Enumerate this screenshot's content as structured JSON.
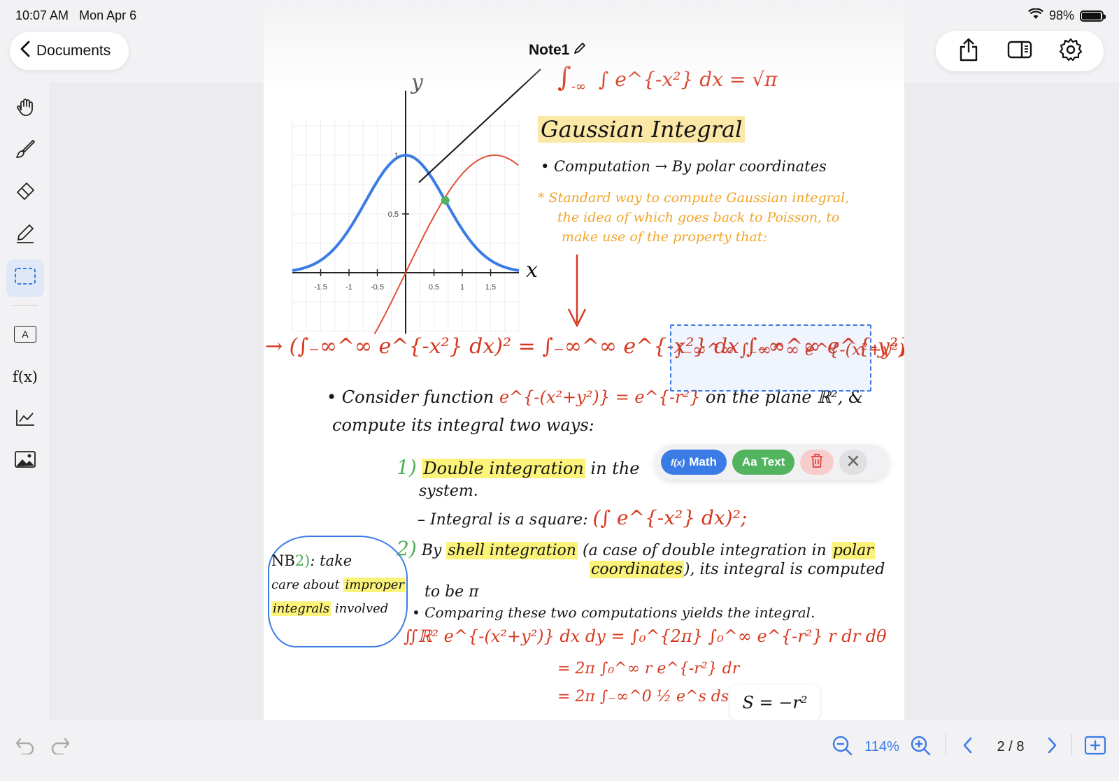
{
  "status": {
    "time": "10:07 AM",
    "date": "Mon Apr 6",
    "battery": "98%",
    "battery_level": 0.98
  },
  "nav": {
    "back_label": "Documents"
  },
  "document": {
    "title": "Note1"
  },
  "tools": [
    "hand-tool",
    "brush-tool",
    "eraser-tool",
    "highlighter-tool",
    "lasso-select-tool",
    "text-box-tool",
    "function-tool",
    "graph-tool",
    "image-tool"
  ],
  "tool_labels": {
    "textbox": "A",
    "function": "f(x)"
  },
  "graph": {
    "y_label": "y",
    "x_label": "x",
    "x_ticks": [
      "-1.5",
      "-1",
      "-0.5",
      "0.5",
      "1",
      "1.5"
    ],
    "y_ticks": [
      "1",
      "0.5"
    ]
  },
  "notes": {
    "top_formula": "∫ e^{-x²} dx = √π",
    "top_formula_lower": "-∞",
    "heading": "Gaussian Integral",
    "computation": "• Computation → By polar coordinates",
    "note_line1": "* Standard way to compute Gaussian integral,",
    "note_line2": "the idea of which goes back to Poisson, to",
    "note_line3": "make use of the property that:",
    "main_equation": "→ (∫₋∞^∞ e^{-x²} dx)² = ∫₋∞^∞ e^{-x²} dx ∫₋∞^∞ e^{-y²} dy =",
    "selected_expr": "∫₋∞^∞ ∫₋∞^∞ e^{-(x²+y²)} dx dy",
    "consider_line1a": "• Consider function",
    "consider_expr": "e^{-(x²+y²)} = e^{-r²}",
    "consider_line1b": "on the plane ℝ², &",
    "consider_line2": "compute its integral two ways:",
    "step1_num": "1)",
    "step1_hl": "Double integration",
    "step1_rest": "in the",
    "step1_line2": "system.",
    "step1_line3": "– Integral is a square:",
    "step1_expr": "(∫ e^{-x²} dx)²;",
    "step2_num": "2)",
    "step2_by": "By",
    "step2_hl": "shell integration",
    "step2_rest": "(a case of double integration in",
    "step2_hl2": "polar",
    "step2_hl3": "coordinates",
    "step2_line2b": "), its integral is computed",
    "step2_line3": "to be π",
    "compare": "• Comparing these two computations yields the integral.",
    "final_line1": "∬ℝ² e^{-(x²+y²)} dx dy = ∫₀^{2π} ∫₀^∞ e^{-r²} r dr dθ",
    "final_line2": "= 2π ∫₀^∞ r e^{-r²} dr",
    "final_line3": "= 2π ∫₋∞^0 ½ e^s ds",
    "nb_prefix": "NB",
    "nb_num": "2)",
    "nb_line1": ": take",
    "nb_line2a": "care about",
    "nb_line2b": "improper",
    "nb_line3a": "integrals",
    "nb_line3b": "involved",
    "formula_box": "S = −r²"
  },
  "popup": {
    "math_label": "Math",
    "math_icon": "f(x)",
    "text_label": "Text",
    "text_icon": "Aa"
  },
  "bottom": {
    "zoom": "114%",
    "page": "2 / 8"
  },
  "colors": {
    "accent": "#3b7be6",
    "red_ink": "#d6381f",
    "orange_ink": "#f0a52b",
    "highlight": "#fbf37a",
    "green": "#52b45e"
  }
}
